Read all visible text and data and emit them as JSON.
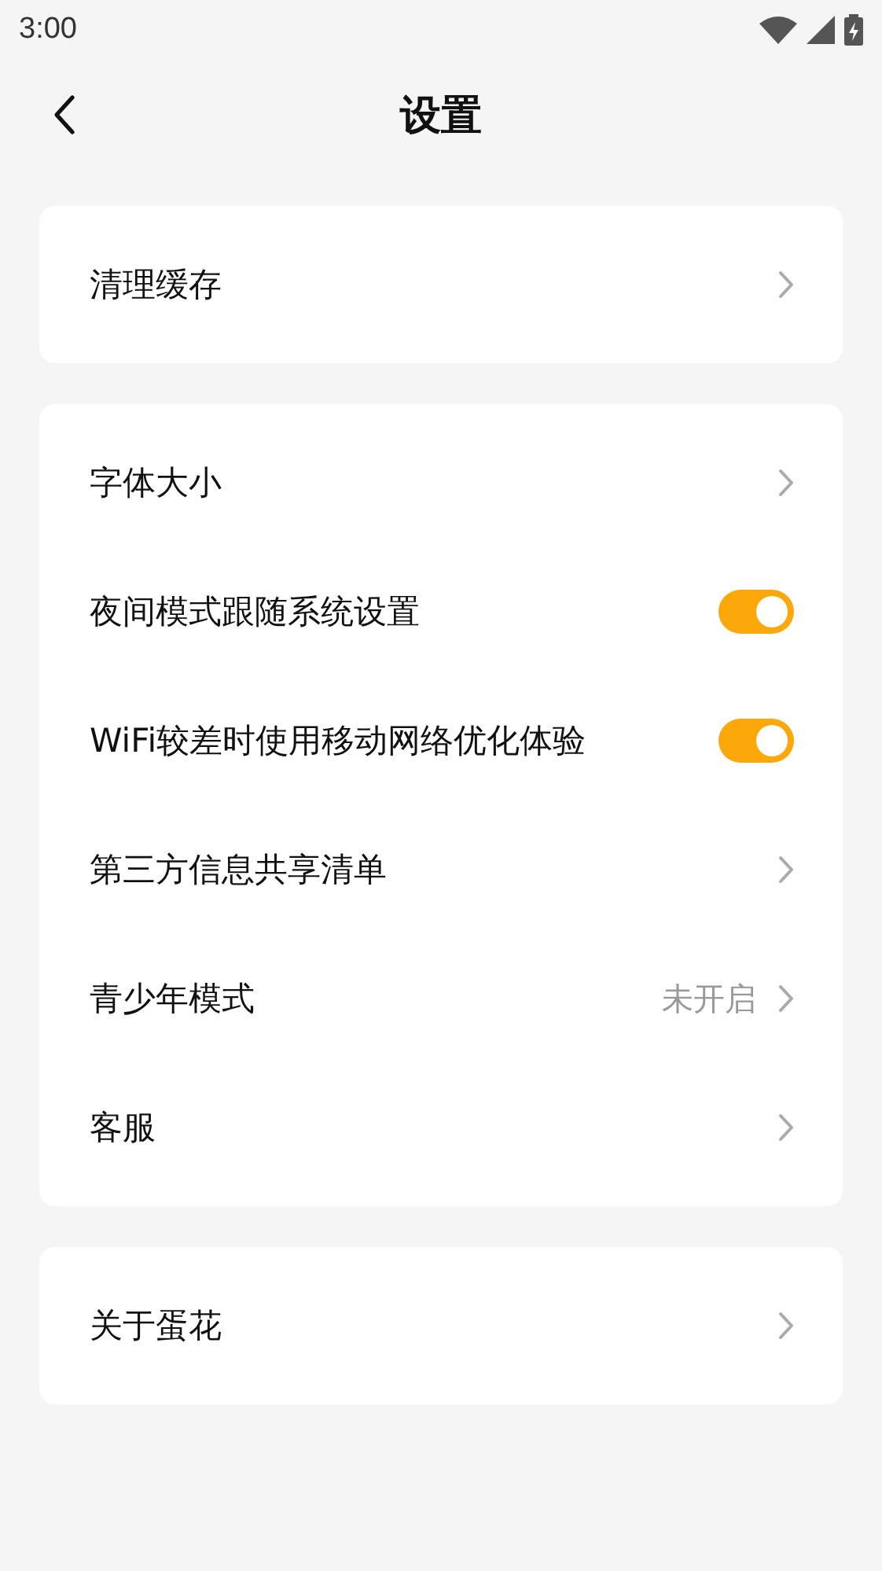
{
  "status_bar": {
    "time": "3:00"
  },
  "header": {
    "title": "设置"
  },
  "groups": [
    {
      "items": [
        {
          "kind": "link",
          "label": "清理缓存"
        }
      ]
    },
    {
      "items": [
        {
          "kind": "link",
          "label": "字体大小"
        },
        {
          "kind": "toggle",
          "label": "夜间模式跟随系统设置",
          "on": true
        },
        {
          "kind": "toggle",
          "label": "WiFi较差时使用移动网络优化体验",
          "on": true
        },
        {
          "kind": "link",
          "label": "第三方信息共享清单"
        },
        {
          "kind": "link",
          "label": "青少年模式",
          "value": "未开启"
        },
        {
          "kind": "link",
          "label": "客服"
        }
      ]
    },
    {
      "items": [
        {
          "kind": "link",
          "label": "关于蛋花"
        }
      ]
    }
  ]
}
